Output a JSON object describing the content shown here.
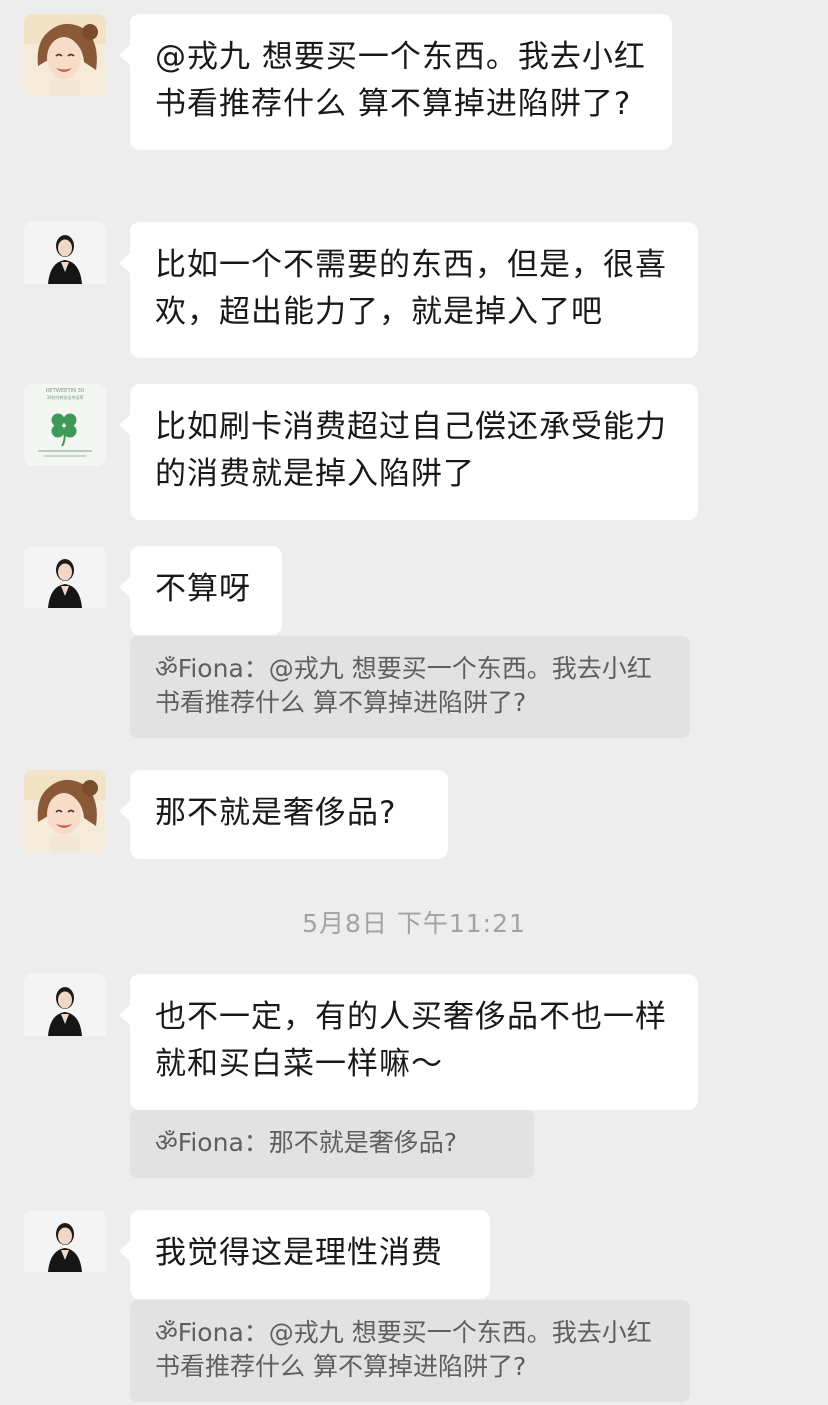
{
  "messages": [
    {
      "avatar": "avatar-girl-icon",
      "text": "@戎九 想要买一个东西。我去小红书看推荐什么 算不算掉进陷阱了?"
    },
    {
      "avatar": "avatar-woman-suit-icon",
      "text": "比如一个不需要的东西，但是，很喜欢，超出能力了，就是掉入了吧"
    },
    {
      "avatar": "avatar-clover-card-icon",
      "text": "比如刷卡消费超过自己偿还承受能力的消费就是掉入陷阱了"
    },
    {
      "avatar": "avatar-woman-suit-icon",
      "text": "不算呀",
      "quote": "ॐFiona：@戎九 想要买一个东西。我去小红书看推荐什么 算不算掉进陷阱了?"
    },
    {
      "avatar": "avatar-girl-icon",
      "text": "那不就是奢侈品?"
    },
    {
      "avatar": "avatar-woman-suit-icon",
      "text": "也不一定，有的人买奢侈品不也一样就和买白菜一样嘛～",
      "quote": "ॐFiona：那不就是奢侈品?"
    },
    {
      "avatar": "avatar-woman-suit-icon",
      "text": "我觉得这是理性消费",
      "quote": "ॐFiona：@戎九 想要买一个东西。我去小红书看推荐什么 算不算掉进陷阱了?"
    }
  ],
  "timestamp": "5月8日 下午11:21",
  "clover_card": {
    "line1": "RETWEETIN 30",
    "line2": "30秒内转发出幸运草"
  },
  "colors": {
    "background": "#ededed",
    "bubble": "#ffffff",
    "quote": "#e2e2e2",
    "text": "#191919",
    "quote_text": "#5f5f5f",
    "timestamp": "#a3a3a3"
  }
}
